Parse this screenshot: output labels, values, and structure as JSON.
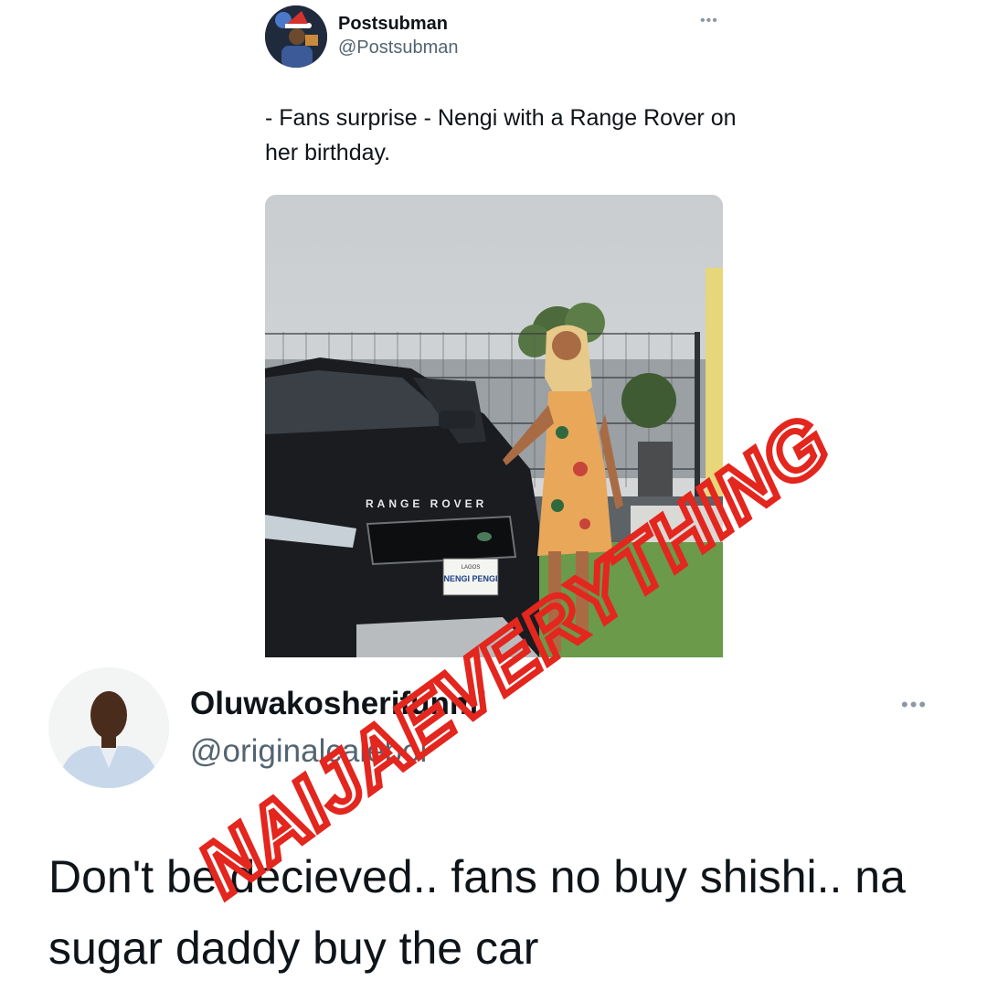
{
  "quoted_tweet": {
    "author_name": "Postsubman",
    "author_handle": "@Postsubman",
    "more_icon": "more-dots-icon",
    "text": "- Fans surprise - Nengi with a Range Rover on her birthday.",
    "photo": {
      "car_badge": "RANGE ROVER",
      "plate_top": "LAGOS",
      "plate_text": "NENGI PENGI"
    }
  },
  "reply_tweet": {
    "author_name": "Oluwakosherifunmi",
    "author_handle": "@originalcaleboi",
    "more_icon": "more-dots-icon",
    "text": "Don't be decieved.. fans no buy shishi.. na sugar daddy buy the car"
  },
  "watermark": {
    "text": "NAIJAEVERYTHING",
    "color": "#e3261e"
  },
  "colors": {
    "text_primary": "#0f1419",
    "text_secondary": "#536471"
  }
}
